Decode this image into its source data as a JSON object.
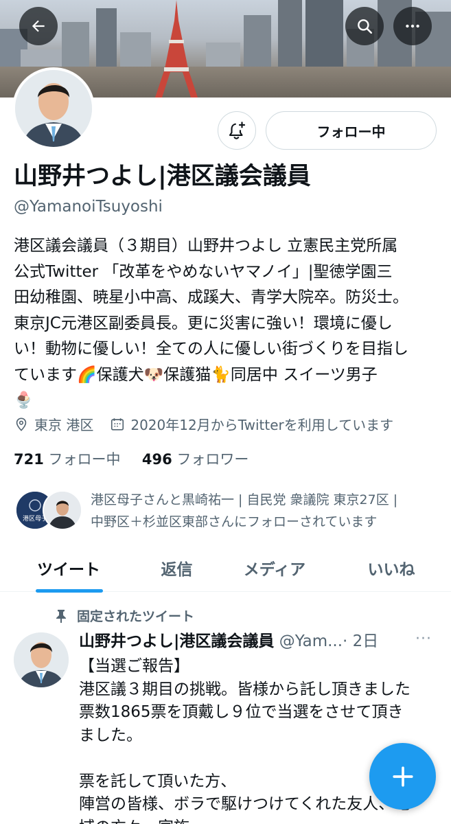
{
  "header": {
    "back_icon": "arrow-left-icon",
    "search_icon": "search-icon",
    "more_icon": "more-horizontal-icon"
  },
  "profile": {
    "display_name": "山野井つよし|港区議会議員",
    "handle": "@YamanoiTsuyoshi",
    "follow_button_label": "フォロー中",
    "notify_icon": "bell-plus-icon",
    "bio_lines": [
      "港区議会議員（３期目）山野井つよし 立憲民主党所属",
      "公式Twitter 「改革をやめないヤマノイ」|聖徳学園三",
      "田幼稚園、暁星小中高、成蹊大、青学大院卒。防災士。",
      "東京JC元港区副委員長。更に災害に強い！環境に優し",
      "い！動物に優しい！全ての人に優しい街づくりを目指し",
      "ています🌈保護犬🐶保護猫🐈同居中 スイーツ男子",
      "🍨"
    ],
    "location": "東京 港区",
    "joined": "2020年12月からTwitterを利用しています",
    "following_count": "721",
    "following_label": "フォロー中",
    "followers_count": "496",
    "followers_label": "フォロワー",
    "followed_by_lines": [
      "港区母子さんと黒崎祐一 | 自民党 衆議院 東京27区 |",
      "中野区＋杉並区東部さんにフォローされています"
    ],
    "followed_by_badge": "港区母子"
  },
  "tabs": [
    {
      "label": "ツイート",
      "active": true
    },
    {
      "label": "返信",
      "active": false
    },
    {
      "label": "メディア",
      "active": false
    },
    {
      "label": "いいね",
      "active": false
    }
  ],
  "tweet": {
    "pinned_label": "固定されたツイート",
    "author_name": "山野井つよし|港区議会議員",
    "author_handle": "@Yam...",
    "time": "· 2日",
    "more": "···",
    "body_lines": [
      "【当選ご報告】",
      "港区議３期目の挑戦。皆様から託し頂きました",
      "票数1865票を頂戴し９位で当選をさせて頂き",
      "ました。",
      "",
      "票を託して頂いた方、",
      "陣営の皆様、ボラで駆けつけてくれた友人、地",
      "域の方々、家族"
    ]
  },
  "fab": {
    "icon": "plus-icon"
  },
  "colors": {
    "accent": "#1d9bf0",
    "text": "#0f1419",
    "muted": "#536471"
  }
}
